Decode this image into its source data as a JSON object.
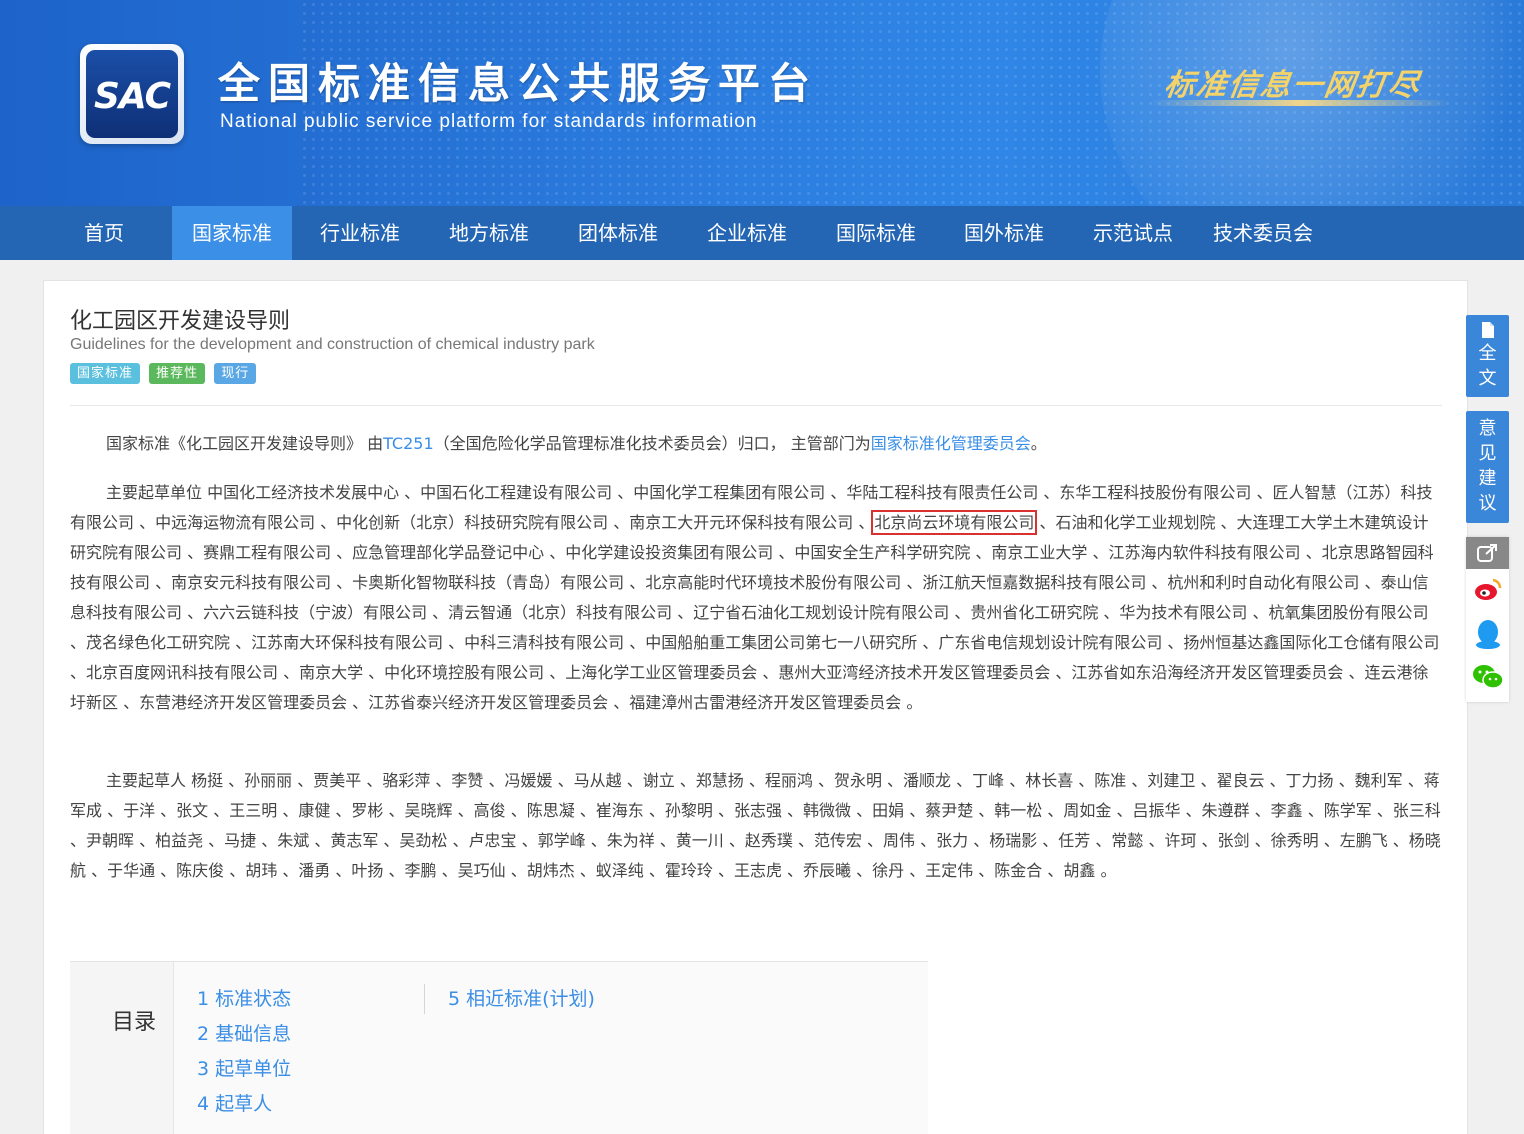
{
  "header": {
    "logo_text": "SAC",
    "title": "全国标准信息公共服务平台",
    "subtitle": "National public service platform  for standards information",
    "slogan": "标准信息一网打尽"
  },
  "nav": {
    "items": [
      "首页",
      "国家标准",
      "行业标准",
      "地方标准",
      "团体标准",
      "企业标准",
      "国际标准",
      "国外标准",
      "示范试点",
      "技术委员会"
    ],
    "active_index": 1
  },
  "standard": {
    "title": "化工园区开发建设导则",
    "title_en": "Guidelines for the development and construction of chemical industry park",
    "badges": [
      "国家标准",
      "推荐性",
      "现行"
    ]
  },
  "intro": {
    "prefix": "国家标准《化工园区开发建设导则》 由",
    "tc_link": "TC251",
    "middle": "（全国危险化学品管理标准化技术委员会）归口， 主管部门为",
    "dept_link": "国家标准化管理委员会",
    "suffix": "。"
  },
  "drafting_units": {
    "before": "主要起草单位 中国化工经济技术发展中心 、中国石化工程建设有限公司 、中国化学工程集团有限公司 、华陆工程科技有限责任公司 、东华工程科技股份有限公司 、匠人智慧（江苏）科技有限公司 、中远海运物流有限公司 、中化创新（北京）科技研究院有限公司 、南京工大开元环保科技有限公司 、",
    "highlighted": "北京尚云环境有限公司",
    "after": " 、石油和化学工业规划院 、大连理工大学土木建筑设计研究院有限公司 、赛鼎工程有限公司 、应急管理部化学品登记中心 、中化学建设投资集团有限公司 、中国安全生产科学研究院 、南京工业大学 、江苏海内软件科技有限公司 、北京思路智园科技有限公司 、南京安元科技有限公司 、卡奥斯化智物联科技（青岛）有限公司 、北京高能时代环境技术股份有限公司 、浙江航天恒嘉数据科技有限公司 、杭州和利时自动化有限公司 、泰山信息科技有限公司 、六六云链科技（宁波）有限公司 、清云智通（北京）科技有限公司 、辽宁省石油化工规划设计院有限公司 、贵州省化工研究院 、华为技术有限公司 、杭氧集团股份有限公司 、茂名绿色化工研究院 、江苏南大环保科技有限公司 、中科三清科技有限公司 、中国船舶重工集团公司第七一八研究所 、广东省电信规划设计院有限公司 、扬州恒基达鑫国际化工仓储有限公司 、北京百度网讯科技有限公司 、南京大学 、中化环境控股有限公司 、上海化学工业区管理委员会 、惠州大亚湾经济技术开发区管理委员会 、江苏省如东沿海经济开发区管理委员会 、连云港徐圩新区 、东营港经济开发区管理委员会 、江苏省泰兴经济开发区管理委员会 、福建漳州古雷港经济开发区管理委员会 。"
  },
  "drafters": {
    "text": "主要起草人 杨挺 、孙丽丽 、贾美平 、骆彩萍 、李赞 、冯媛媛 、马从越 、谢立 、郑慧扬 、程丽鸿 、贺永明 、潘顺龙 、丁峰 、林长喜 、陈准 、刘建卫 、翟良云 、丁力扬 、魏利军 、蒋军成 、于洋 、张文 、王三明 、康健 、罗彬 、吴晓辉 、高俊 、陈思凝 、崔海东 、孙黎明 、张志强 、韩微微 、田娟 、蔡尹楚 、韩一松 、周如金 、吕振华 、朱遵群 、李鑫 、陈学军 、张三科 、尹朝晖 、柏益尧 、马捷 、朱斌 、黄志军 、吴劲松 、卢忠宝 、郭学峰 、朱为祥 、黄一川 、赵秀璞 、范传宏 、周伟 、张力 、杨瑞影 、任芳 、常懿 、许珂 、张剑 、徐秀明 、左鹏飞 、杨晓航 、于华通 、陈庆俊 、胡玮 、潘勇 、叶扬 、李鹏 、吴巧仙 、胡炜杰 、蚁泽纯 、霍玲玲 、王志虎 、乔辰曦 、徐丹 、王定伟 、陈金合 、胡鑫 。"
  },
  "toc": {
    "label": "目录",
    "left_items": [
      "1  标准状态",
      "2  基础信息",
      "3  起草单位",
      "4  起草人"
    ],
    "right_items": [
      "5  相近标准(计划)"
    ]
  },
  "sidebar": {
    "fulltext_label": [
      "全",
      "文"
    ],
    "feedback_label": [
      "意",
      "见",
      "建",
      "议"
    ],
    "share_icons": [
      "share-icon",
      "weibo-icon",
      "qq-icon",
      "wechat-icon"
    ]
  },
  "colors": {
    "nav_bg": "#2466b4",
    "nav_active": "#3c8fe6",
    "link": "#3a8ee6",
    "highlight_border": "#d93030"
  }
}
